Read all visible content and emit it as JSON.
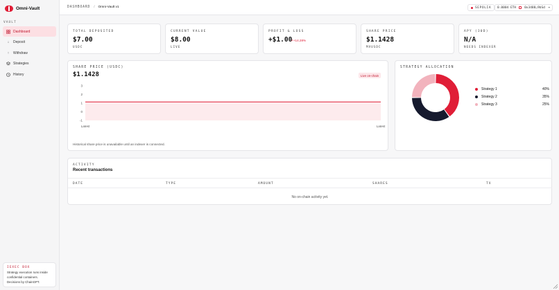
{
  "brand": {
    "name": "Omni-Vault"
  },
  "sidebar": {
    "section": "VAULT",
    "items": [
      {
        "label": "Dashboard",
        "icon": "grid-icon",
        "active": true
      },
      {
        "label": "Deposit",
        "icon": "arrow-down-icon"
      },
      {
        "label": "Withdraw",
        "icon": "arrow-up-icon"
      },
      {
        "label": "Strategies",
        "icon": "layers-icon"
      },
      {
        "label": "History",
        "icon": "clock-icon"
      }
    ],
    "tee": {
      "title": "IEXEC BOX",
      "text_line1": "Strategy execution runs inside",
      "text_line2": "confidential containers.",
      "text_line3": "Decisions by ChainGPT."
    }
  },
  "topbar": {
    "breadcrumb_root": "DASHBOARD",
    "breadcrumb_sep": "/",
    "breadcrumb_current": "Omni-Vault v1",
    "network": "SEPOLIA",
    "balance": "0.0004 ETH",
    "address": "0x3488…9bSd"
  },
  "kpis": [
    {
      "label": "TOTAL DEPOSITED",
      "value": "$7.00",
      "sub": "USDC"
    },
    {
      "label": "CURRENT VALUE",
      "value": "$8.00",
      "sub": "LIVE"
    },
    {
      "label": "PROFIT & LOSS",
      "value": "+$1.00",
      "change": "↗+14.28%"
    },
    {
      "label": "SHARE PRICE",
      "value": "$1.1428",
      "sub": "MVUSDC"
    },
    {
      "label": "APY (30D)",
      "value": "N/A",
      "sub": "NEEDS INDEXER"
    }
  ],
  "share_panel": {
    "label": "SHARE PRICE (USDC)",
    "value": "$1.1428",
    "badge": "Live on-chain",
    "note": "Historical share price is unavailable until an indexer is connected."
  },
  "chart_data": {
    "type": "line",
    "x": [
      "Latest",
      "Latest"
    ],
    "values": [
      1.1428,
      1.1428
    ],
    "yticks": [
      3,
      2,
      1,
      0,
      -1
    ],
    "ylim": [
      -1,
      3
    ],
    "colors": {
      "line": "#e01e37",
      "fill": "#fde7ea"
    }
  },
  "allocation": {
    "label": "STRATEGY ALLOCATION",
    "items": [
      {
        "name": "Strategy 1",
        "pct": 40,
        "pct_label": "40%",
        "color": "#e01e37"
      },
      {
        "name": "Strategy 2",
        "pct": 35,
        "pct_label": "35%",
        "color": "#161a2e"
      },
      {
        "name": "Strategy 3",
        "pct": 25,
        "pct_label": "25%",
        "color": "#f2b3bd"
      }
    ]
  },
  "transactions": {
    "label": "ACTIVITY",
    "title": "Recent transactions",
    "columns": [
      "DATE",
      "TYPE",
      "AMOUNT",
      "SHARES",
      "TX"
    ],
    "empty": "No on-chain activity yet."
  }
}
